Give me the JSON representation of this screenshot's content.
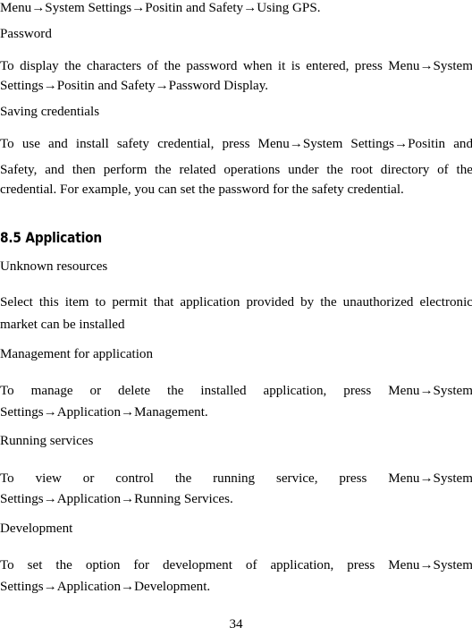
{
  "document": {
    "page_number": "34",
    "background_color": "#ffffff",
    "text_color": "#000000"
  },
  "blocks": {
    "intro_path_line": "Menu→System Settings→Positin and Safety→Using GPS.",
    "password_subheading": "Password",
    "password_body": "To display the characters of the password when it is entered, press Menu→System Settings→Positin and Safety→Password Display.",
    "saving_credentials_subheading": "Saving credentials",
    "saving_credentials_body": "To use and install safety credential, press Menu→System Settings→Positin and Safety, and then perform the related operations under the root directory of the credential. For example, you can set the password for the safety credential.",
    "section_heading": "8.5 Application",
    "unknown_resources_subheading": "Unknown resources",
    "unknown_resources_body": "Select this item to permit that application provided by the unauthorized electronic market can be installed",
    "management_subheading": "Management for application",
    "management_body": "To manage or delete the installed application, press Menu→System Settings→Application→Management.",
    "running_services_subheading": "Running services",
    "running_services_body": "To view or control the running service, press Menu→System Settings→Application→Running Services.",
    "development_subheading": "Development",
    "development_body": "To set the option for development of application, press Menu→System Settings→Application→Development."
  },
  "lines": {
    "l01": "Menu→System Settings→Positin and Safety→Using GPS.",
    "l02": "Password",
    "l03": "To display the characters of the password when it is entered, press Menu→System",
    "l04": "Settings→Positin and Safety→Password Display.",
    "l05": "Saving credentials",
    "l06": "To use and install safety credential, press Menu→System Settings→Positin and",
    "l07": "Safety, and then perform the related operations under the root directory of the",
    "l08": "credential. For example, you can set the password for the safety credential.",
    "l09": "8.5 Application",
    "l10": "Unknown resources",
    "l11": "Select this item to permit that application provided by the unauthorized electronic",
    "l12": "market can be installed",
    "l13": "Management for application",
    "l14": "To manage or delete the installed application, press Menu→System",
    "l15": "Settings→Application→Management.",
    "l16": "Running services",
    "l17": "To view or control the running service, press Menu→System",
    "l18": "Settings→Application→Running Services.",
    "l19": "Development",
    "l20": "To set the option for development of application, press Menu→System",
    "l21": "Settings→Application→Development.",
    "l22": "34"
  }
}
